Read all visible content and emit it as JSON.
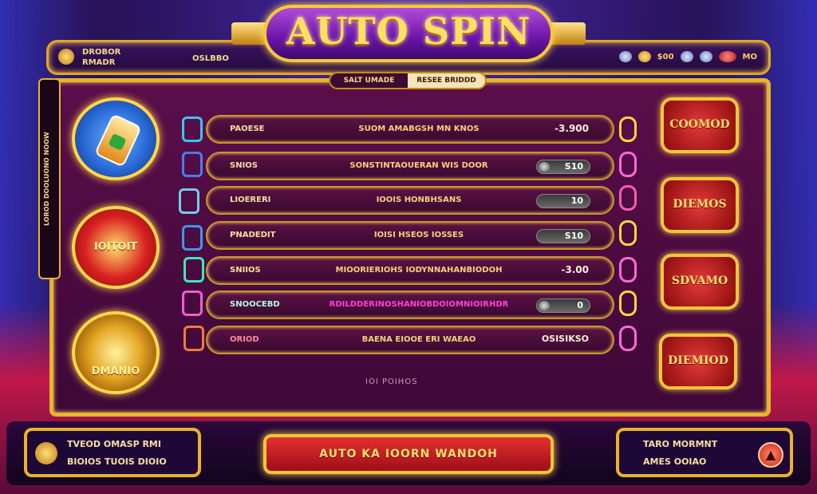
{
  "title": "AUTO SPIN",
  "topbar": {
    "left_line1": "DROBOR",
    "left_line2": "RMADR",
    "mid": "OSLBBO",
    "right_lbl": "$00",
    "right_lbl2": "MO"
  },
  "side_strip": "LOROD DOOLUONO NOOW",
  "tabs": [
    "SALT UMADE",
    "RESEE BRIDDD"
  ],
  "medallions": [
    {
      "label": ""
    },
    {
      "label": "IOITOIT"
    },
    {
      "label": "DMANIO"
    }
  ],
  "rows": [
    {
      "c1": "PAOESE",
      "c2": "SUOM AMABGSH MN KNOS",
      "c3": "-3.900"
    },
    {
      "c1": "SNIOS",
      "c2": "SONSTINTAOUERAN WIS DOOR",
      "toggle": "S10"
    },
    {
      "c1": "LIOERERI",
      "c2": "IOOIS HONBHSANS",
      "toggle": "10"
    },
    {
      "c1": "PNADEDIT",
      "c2": "IOISI HSEOS IOSSES",
      "toggle": "S10"
    },
    {
      "c1": "SNIIOS",
      "c2": "MIOORIERIOHS IODYNNAHANBIODOH",
      "c3": "-3.00"
    },
    {
      "c1": "SNOOCEBD",
      "c2": "RDILDDERINOSHANIOBDOIOMNIOIRHDR",
      "toggle": "0"
    },
    {
      "c1": "ORIOD",
      "c2": "BAENA EIOOE ERI WAEAO",
      "c3": "OSISIKSO"
    }
  ],
  "footer_note": "IOI POIHOS",
  "cards": [
    "COOMOD",
    "DIEMOS",
    "SDVAMO",
    "DIEMIOD"
  ],
  "bottom": {
    "left_l1": "TVEOD  OMASP RMI",
    "left_l2": "BIOIOS TUOIS DIOIO",
    "main_button": "AUTO KA IOORN WANDOH",
    "right_l1": "TARO  MORMNT",
    "right_l2": "AMES  OOIAO"
  }
}
